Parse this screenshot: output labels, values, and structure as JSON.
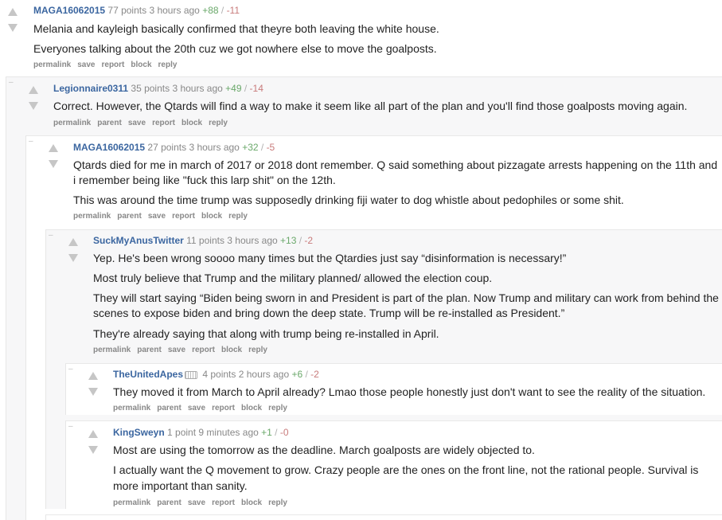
{
  "buttons": {
    "permalink": "permalink",
    "parent": "parent",
    "save": "save",
    "report": "report",
    "block": "block",
    "reply": "reply"
  },
  "collapse_symbol": "–",
  "comments": [
    {
      "author": "MAGA16062015",
      "points": "77 points",
      "time": "3 hours ago",
      "ups": "+88",
      "downs": "-11",
      "paragraphs": [
        "Melania and kayleigh basically confirmed that theyre both leaving the white house.",
        "Everyones talking about the 20th cuz we got nowhere else to move the goalposts."
      ]
    },
    {
      "author": "Legionnaire0311",
      "points": "35 points",
      "time": "3 hours ago",
      "ups": "+49",
      "downs": "-14",
      "paragraphs": [
        "Correct. However, the Qtards will find a way to make it seem like all part of the plan and you'll find those goalposts moving again."
      ]
    },
    {
      "author": "MAGA16062015",
      "points": "27 points",
      "time": "3 hours ago",
      "ups": "+32",
      "downs": "-5",
      "paragraphs": [
        "Qtards died for me in march of 2017 or 2018 dont remember. Q said something about pizzagate arrests happening on the 11th and",
        "i remember being like \"fuck this larp shit\" on the 12th.",
        "This was around the time trump was supposedly drinking fiji water to dog whistle about pedophiles or some shit."
      ]
    },
    {
      "author": "SuckMyAnusTwitter",
      "points": "11 points",
      "time": "3 hours ago",
      "ups": "+13",
      "downs": "-2",
      "paragraphs": [
        "Yep. He's been wrong soooo many times but the Qtardies just say “disinformation is necessary!”",
        "Most truly believe that Trump and the military planned/ allowed the election coup.",
        "They will start saying “Biden being sworn in and President is part of the plan. Now Trump and military can work from behind the",
        "scenes to expose biden and bring down the deep state. Trump will be re-installed as President.”",
        "They're already saying that along with trump being re-installed in April."
      ]
    },
    {
      "author": "TheUnitedApes",
      "points": "4 points",
      "time": "2 hours ago",
      "ups": "+6",
      "downs": "-2",
      "paragraphs": [
        "They moved it from March to April already? Lmao those people honestly just don't want to see the reality of the situation."
      ]
    },
    {
      "author": "KingSweyn",
      "points": "1 point",
      "time": "9 minutes ago",
      "ups": "+1",
      "downs": "-0",
      "paragraphs": [
        "Most are using the tomorrow as the deadline. March goalposts are widely objected to.",
        "I actually want the Q movement to grow. Crazy people are the ones on the front line, not the rational people. Survival is",
        "more important than sanity."
      ]
    }
  ]
}
